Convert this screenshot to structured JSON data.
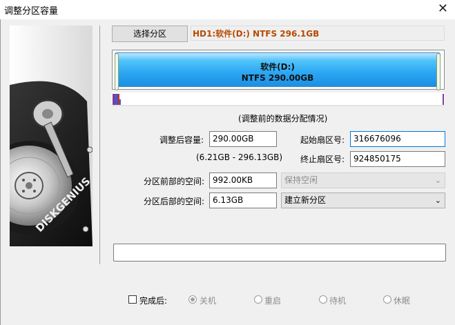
{
  "window": {
    "title": "调整分区容量",
    "close_glyph": "✕"
  },
  "top": {
    "select_partition_label": "选择分区",
    "disk_info": "HD1:软件(D:) NTFS 296.1GB"
  },
  "partition_bar": {
    "name": "软件(D:)",
    "fs_size": "NTFS 290.00GB"
  },
  "distribution_caption": "(调整前的数据分配情况)",
  "fields": {
    "size_after_label": "调整后容量:",
    "size_after_value": "290.00GB",
    "size_range": "(6.21GB - 296.13GB)",
    "start_sector_label": "起始扇区号:",
    "start_sector_value": "316676096",
    "end_sector_label": "终止扇区号:",
    "end_sector_value": "924850175",
    "space_before_label": "分区前部的空间:",
    "space_before_value": "992.00KB",
    "space_before_action": "保持空闲",
    "space_after_label": "分区后部的空间:",
    "space_after_value": "6.13GB",
    "space_after_action": "建立新分区"
  },
  "after_completion": {
    "label": "完成后:",
    "options": [
      "关机",
      "重启",
      "待机",
      "休眠"
    ],
    "selected": "关机"
  },
  "logo_text": "DISKGENIUS",
  "colors": {
    "disk_info_text": "#b84a00",
    "partition_fill": "#2aa6f2",
    "accent": "#0078d7"
  }
}
